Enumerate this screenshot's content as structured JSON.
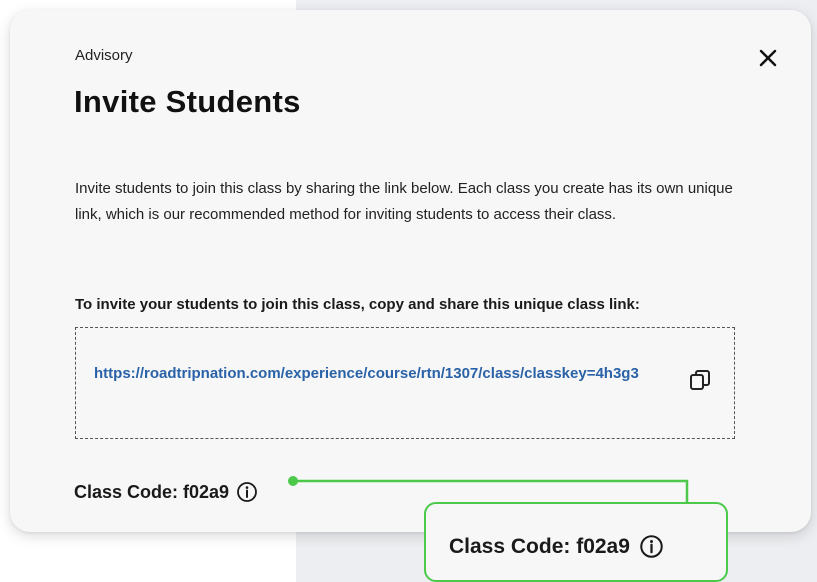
{
  "modal": {
    "subtitle": "Advisory",
    "title": "Invite Students",
    "description": "Invite students to join this class by sharing the link below. Each class you create has its own unique link, which is our recommended method for inviting students to access their class.",
    "instruction": "To invite your students to join this class, copy and share this unique class link:",
    "class_link": "https://roadtripnation.com/experience/course/rtn/1307/class/classkey=4h3g3",
    "class_code": "Class Code: f02a9"
  },
  "callout": {
    "class_code": "Class Code: f02a9"
  },
  "icons": {
    "close": "close-icon",
    "copy": "copy-icon",
    "info": "info-icon"
  },
  "colors": {
    "link": "#2a62a8",
    "callout_border": "#4cc94a",
    "modal_bg": "#f7f7f7",
    "page_bg": "#eceef1"
  }
}
